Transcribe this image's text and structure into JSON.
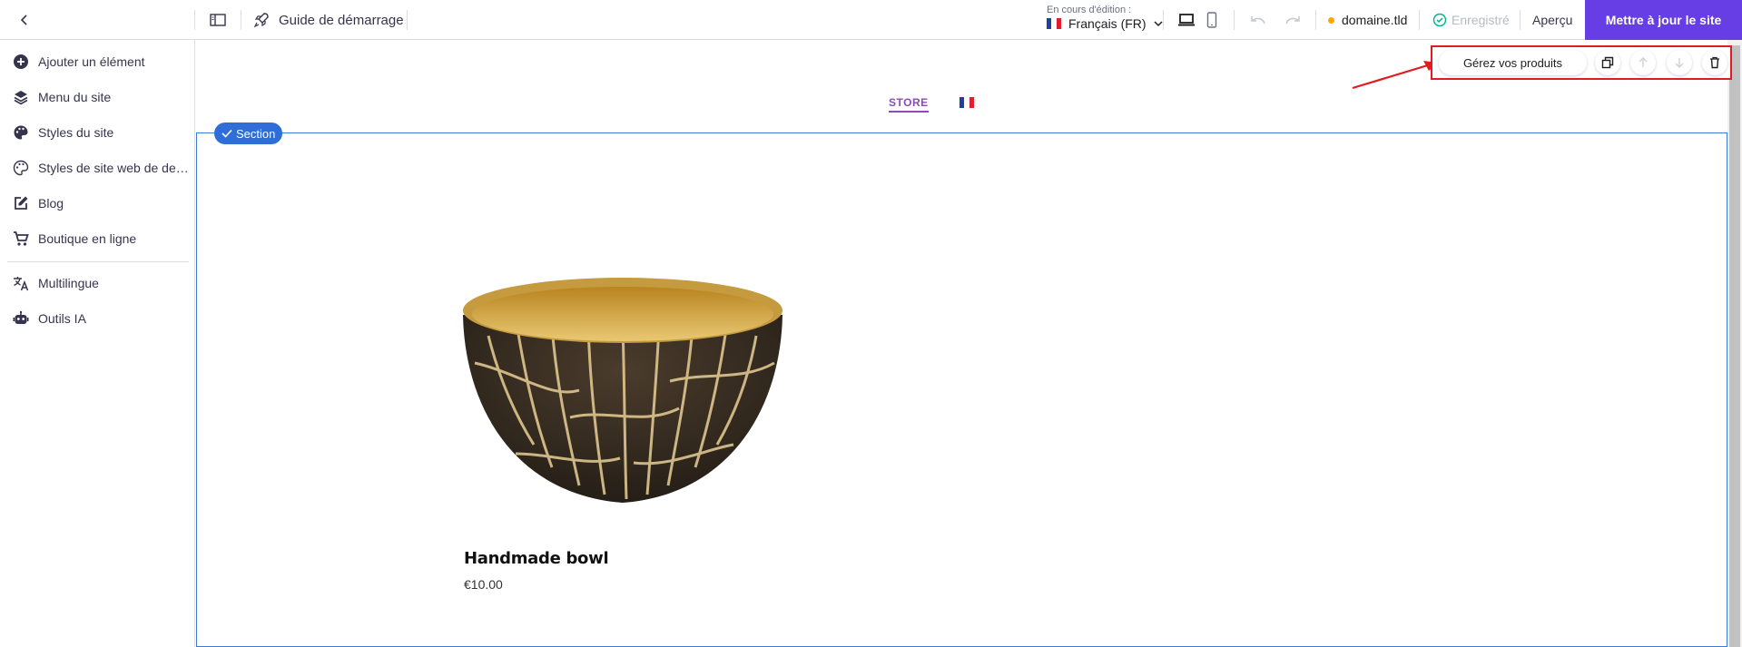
{
  "header": {
    "guide_label": "Guide de démarrage",
    "editing_label": "En cours d'édition :",
    "language_label": "Français (FR)",
    "domain_label": "domaine.tld",
    "saved_label": "Enregistré",
    "preview_label": "Aperçu",
    "publish_label": "Mettre à jour le site"
  },
  "sidebar": {
    "items": [
      {
        "label": "Ajouter un élément",
        "icon": "plus-circle-icon"
      },
      {
        "label": "Menu du site",
        "icon": "layers-icon"
      },
      {
        "label": "Styles du site",
        "icon": "palette-icon"
      },
      {
        "label": "Styles de site web de design",
        "icon": "palette-outline-icon"
      },
      {
        "label": "Blog",
        "icon": "edit-note-icon"
      },
      {
        "label": "Boutique en ligne",
        "icon": "cart-icon"
      },
      {
        "label": "Multilingue",
        "icon": "translate-icon"
      },
      {
        "label": "Outils IA",
        "icon": "robot-icon"
      }
    ]
  },
  "canvas": {
    "nav_store": "STORE",
    "section_badge": "Section",
    "manage_products": "Gérez vos produits",
    "product": {
      "name": "Handmade bowl",
      "price": "€10.00"
    }
  },
  "colors": {
    "accent": "#673de6",
    "selection": "#2f6ed8",
    "highlight": "#e11b22",
    "store_link": "#8c4bb6"
  }
}
